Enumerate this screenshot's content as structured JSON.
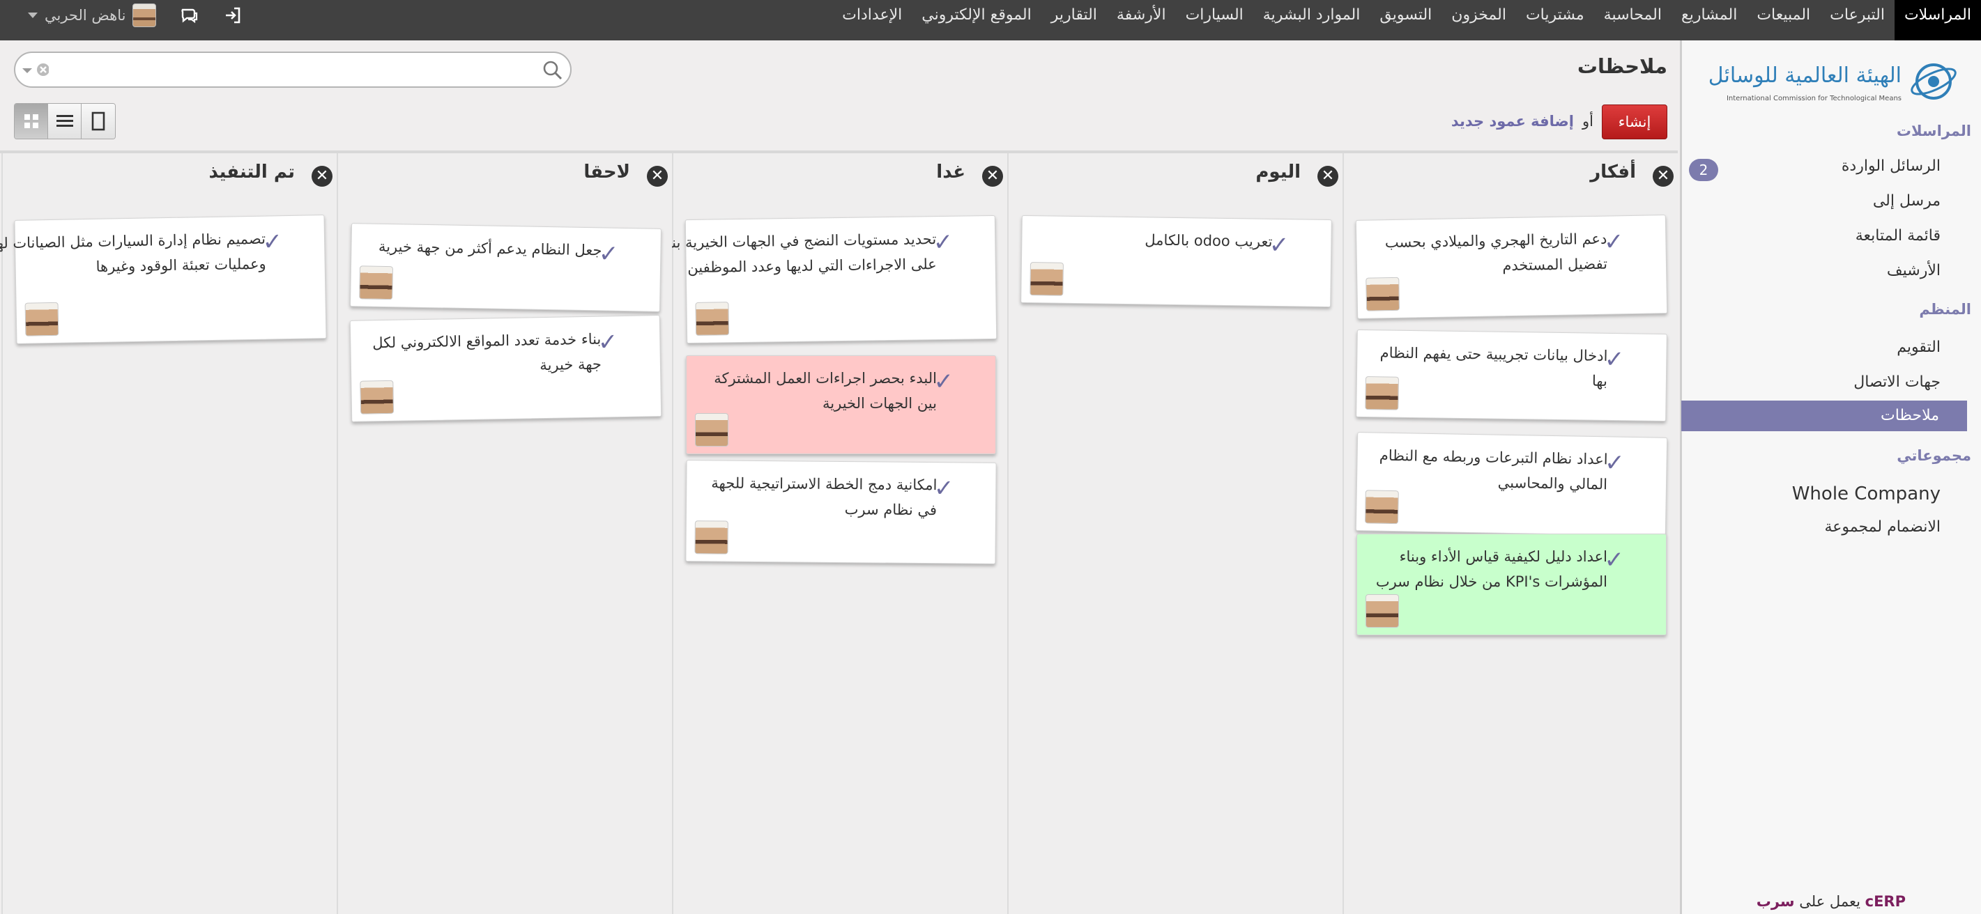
{
  "topbar": {
    "menu": [
      "المراسلات",
      "التبرعات",
      "المبيعات",
      "المشاريع",
      "المحاسبة",
      "مشتريات",
      "المخزون",
      "التسويق",
      "الموارد البشرية",
      "السيارات",
      "الأرشفة",
      "التقارير",
      "الموقع الإلكتروني",
      "الإعدادات"
    ],
    "active_index": 0,
    "user_name": "ناهض الحربي",
    "icons": {
      "chat": "chat-icon",
      "logout": "logout-icon"
    }
  },
  "sidebar": {
    "logo_arabic": "الهيئة العالمية للوسائل التقنية",
    "logo_english": "International Commission for Technological Means",
    "sections": [
      {
        "title": "المراسلات",
        "items": [
          {
            "label": "الرسائل الواردة",
            "badge": "2"
          },
          {
            "label": "مرسل إلى"
          },
          {
            "label": "قائمة المتابعة"
          },
          {
            "label": "الأرشيف"
          }
        ]
      },
      {
        "title": "المنظم",
        "items": [
          {
            "label": "التقويم"
          },
          {
            "label": "جهات الاتصال"
          },
          {
            "label": "ملاحظات",
            "selected": true
          }
        ]
      },
      {
        "title": "مجموعاتي",
        "items": [
          {
            "label": "Whole Company"
          },
          {
            "label": "الانضمام لمجموعة"
          }
        ]
      }
    ],
    "footer_prefix": "يعمل على",
    "footer_brand_ar": "سرب",
    "footer_brand_en": "cERP"
  },
  "header": {
    "page_title": "ملاحظات",
    "search_placeholder": "",
    "create_label": "إنشاء",
    "or_label": "أو",
    "add_column_label": "إضافة عمود جديد",
    "view_modes": [
      "kanban",
      "list",
      "form"
    ],
    "active_view": "kanban"
  },
  "columns": [
    {
      "title": "أفكار",
      "cards": [
        {
          "text": "دعم التاريخ الهجري والميلادي بحسب تفضيل المستخدم",
          "color": "white"
        },
        {
          "text": "ادخال بيانات تجريبية حتى يفهم النظام بها",
          "color": "white"
        },
        {
          "text": "اعداد نظام التبرعات وربطه مع النظام المالي والمحاسبي",
          "color": "white"
        },
        {
          "text": "اعداد دليل لكيفية قياس الأداء وبناء المؤشرات KPI's من خلال نظام سرب",
          "color": "green"
        }
      ]
    },
    {
      "title": "اليوم",
      "cards": [
        {
          "text": "تعريب odoo بالكامل",
          "color": "white"
        }
      ]
    },
    {
      "title": "غدا",
      "cards": [
        {
          "text": "تحديد مستويات النضج في الجهات الخيرية بناء على الاجراءات التي لديها وعدد الموظفين",
          "color": "white"
        },
        {
          "text": "البدء بحصر اجراءات العمل المشتركة بين الجهات الخيرية",
          "color": "red"
        },
        {
          "text": "امكانية دمج الخطة الاستراتيجية للجهة في نظام سرب",
          "color": "white"
        }
      ]
    },
    {
      "title": "لاحقا",
      "cards": [
        {
          "text": "جعل النظام يدعم أكثر من جهة خيرية",
          "color": "white"
        },
        {
          "text": "بناء خدمة تعدد المواقع الالكتروني لكل جهة خيرية",
          "color": "white"
        }
      ]
    },
    {
      "title": "تم التنفيذ",
      "cards": [
        {
          "text": "تصميم نظام إدارة السيارات مثل الصيانات لها وعمليات تعبئة الوقود وغيرها",
          "color": "white"
        }
      ]
    }
  ]
}
